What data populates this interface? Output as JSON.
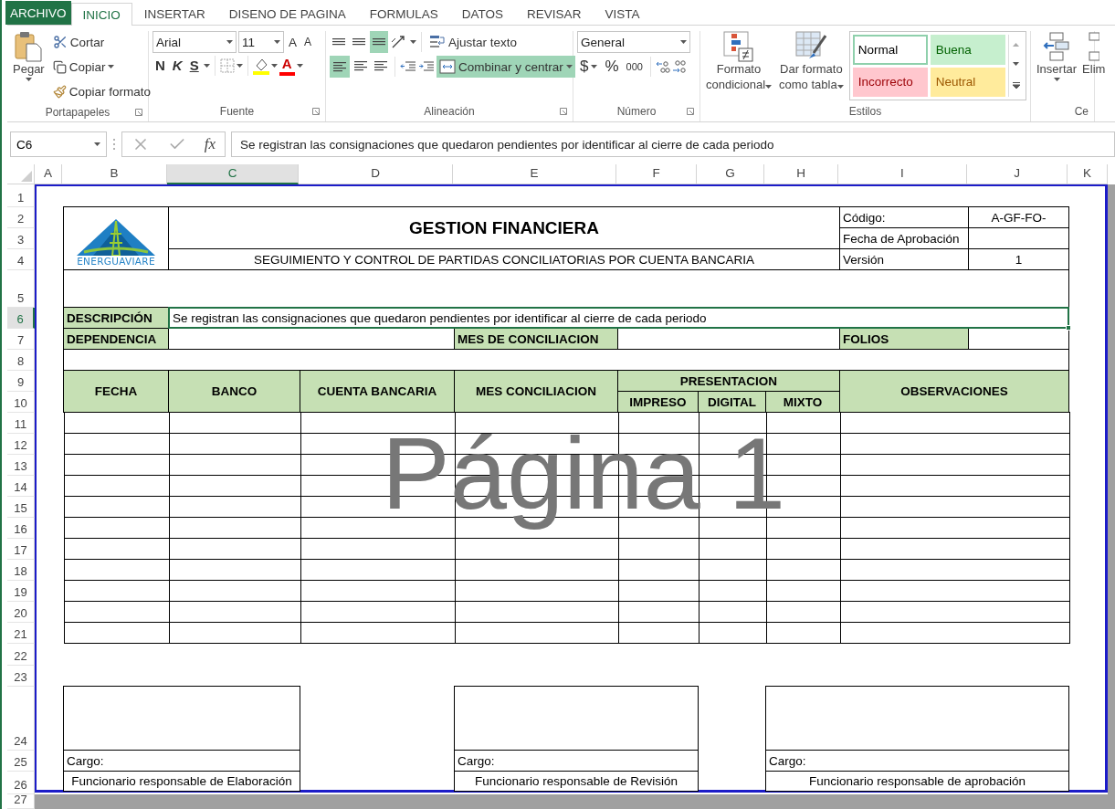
{
  "ribbon_tabs": [
    {
      "label": "ARCHIVO",
      "kind": "file",
      "selected": false
    },
    {
      "label": "INICIO",
      "kind": "tab",
      "selected": true
    },
    {
      "label": "INSERTAR",
      "kind": "tab",
      "selected": false
    },
    {
      "label": "DISENO DE PAGINA",
      "kind": "tab",
      "selected": false
    },
    {
      "label": "FORMULAS",
      "kind": "tab",
      "selected": false
    },
    {
      "label": "DATOS",
      "kind": "tab",
      "selected": false
    },
    {
      "label": "REVISAR",
      "kind": "tab",
      "selected": false
    },
    {
      "label": "VISTA",
      "kind": "tab",
      "selected": false
    }
  ],
  "ribbon": {
    "clipboard": {
      "paste": "Pegar",
      "cut": "Cortar",
      "copy": "Copiar",
      "format_painter": "Copiar formato",
      "label": "Portapapeles"
    },
    "font": {
      "name": "Arial",
      "size": "11",
      "grow": "A",
      "shrink": "A",
      "bold": "N",
      "italic": "K",
      "underline": "S",
      "font_color": "A",
      "label": "Fuente"
    },
    "alignment": {
      "wrap": "Ajustar texto",
      "merge": "Combinar y centrar",
      "bottom_align_on": true,
      "left_align_on": true,
      "merge_on": true,
      "label": "Alineación"
    },
    "number": {
      "format": "General",
      "currency": "$",
      "percent": "%",
      "thousands": "000",
      "label": "Número"
    },
    "styles": {
      "conditional": [
        "Formato",
        "condicional"
      ],
      "table": [
        "Dar formato",
        "como tabla"
      ],
      "label": "Estilos",
      "cells": [
        {
          "label": "Normal",
          "kind": "normal",
          "selected": true
        },
        {
          "label": "Buena",
          "kind": "good",
          "selected": false
        },
        {
          "label": "Incorrecto",
          "kind": "bad",
          "selected": false
        },
        {
          "label": "Neutral",
          "kind": "neutral",
          "selected": false
        }
      ]
    },
    "cells_group": {
      "insert": "Insertar",
      "delete": "Elim",
      "label": "Ce"
    }
  },
  "formula_bar": {
    "name_box": "C6",
    "fx": "fx",
    "formula": "Se registran las consignaciones que quedaron pendientes por identificar al cierre de cada periodo"
  },
  "columns": [
    {
      "label": "A",
      "selected": false
    },
    {
      "label": "B",
      "selected": false
    },
    {
      "label": "C",
      "selected": true
    },
    {
      "label": "D",
      "selected": false
    },
    {
      "label": "E",
      "selected": false
    },
    {
      "label": "F",
      "selected": false
    },
    {
      "label": "G",
      "selected": false
    },
    {
      "label": "H",
      "selected": false
    },
    {
      "label": "I",
      "selected": false
    },
    {
      "label": "J",
      "selected": false
    },
    {
      "label": "K",
      "selected": false
    }
  ],
  "rows": [
    {
      "label": "1",
      "selected": false
    },
    {
      "label": "2",
      "selected": false
    },
    {
      "label": "3",
      "selected": false
    },
    {
      "label": "4",
      "selected": false
    },
    {
      "label": "5",
      "selected": false
    },
    {
      "label": "6",
      "selected": true
    },
    {
      "label": "7",
      "selected": false
    },
    {
      "label": "8",
      "selected": false
    },
    {
      "label": "9",
      "selected": false
    },
    {
      "label": "10",
      "selected": false
    },
    {
      "label": "11",
      "selected": false
    },
    {
      "label": "12",
      "selected": false
    },
    {
      "label": "13",
      "selected": false
    },
    {
      "label": "14",
      "selected": false
    },
    {
      "label": "15",
      "selected": false
    },
    {
      "label": "16",
      "selected": false
    },
    {
      "label": "17",
      "selected": false
    },
    {
      "label": "18",
      "selected": false
    },
    {
      "label": "19",
      "selected": false
    },
    {
      "label": "20",
      "selected": false
    },
    {
      "label": "21",
      "selected": false
    },
    {
      "label": "22",
      "selected": false
    },
    {
      "label": "23",
      "selected": false
    },
    {
      "label": "24",
      "selected": false
    },
    {
      "label": "25",
      "selected": false
    },
    {
      "label": "26",
      "selected": false
    },
    {
      "label": "27",
      "selected": false
    }
  ],
  "cells": [
    {
      "kind": "logo",
      "text": "ENERGUAVIARE",
      "selected": false
    },
    {
      "kind": "title",
      "text": "GESTION FINANCIERA",
      "selected": false
    },
    {
      "kind": "value",
      "text": "SEGUIMIENTO Y CONTROL DE PARTIDAS CONCILIATORIAS POR CUENTA BANCARIA",
      "selected": false
    },
    {
      "kind": "label",
      "text": "Código:",
      "selected": false
    },
    {
      "kind": "value",
      "text": "A-GF-FO-",
      "selected": false
    },
    {
      "kind": "label",
      "text": "Fecha de Aprobación",
      "selected": false
    },
    {
      "kind": "label",
      "text": "Versión",
      "selected": false
    },
    {
      "kind": "value",
      "text": "1",
      "selected": false
    },
    {
      "kind": "field",
      "text": "DESCRIPCIÓN",
      "selected": false
    },
    {
      "kind": "label",
      "text": "Se registran las consignaciones que quedaron pendientes por identificar al cierre de cada periodo",
      "selected": true
    },
    {
      "kind": "field",
      "text": "DEPENDENCIA",
      "selected": false
    },
    {
      "kind": "field",
      "text": "MES DE CONCILIACION",
      "selected": false
    },
    {
      "kind": "field",
      "text": "FOLIOS",
      "selected": false
    },
    {
      "kind": "header",
      "text": "FECHA",
      "selected": false
    },
    {
      "kind": "header",
      "text": "BANCO",
      "selected": false
    },
    {
      "kind": "header",
      "text": "CUENTA BANCARIA",
      "selected": false
    },
    {
      "kind": "header",
      "text": "MES CONCILIACION",
      "selected": false
    },
    {
      "kind": "header",
      "text": "PRESENTACION",
      "selected": false
    },
    {
      "kind": "header",
      "text": "IMPRESO",
      "selected": false
    },
    {
      "kind": "header",
      "text": "DIGITAL",
      "selected": false
    },
    {
      "kind": "header",
      "text": "MIXTO",
      "selected": false
    },
    {
      "kind": "header",
      "text": "OBSERVACIONES",
      "selected": false
    },
    {
      "kind": "label",
      "text": "Cargo:",
      "selected": false
    },
    {
      "kind": "value",
      "text": "Funcionario responsable de Elaboración",
      "selected": false
    },
    {
      "kind": "label",
      "text": "Cargo:",
      "selected": false
    },
    {
      "kind": "value",
      "text": "Funcionario responsable de Revisión",
      "selected": false
    },
    {
      "kind": "label",
      "text": "Cargo:",
      "selected": false
    },
    {
      "kind": "value",
      "text": "Funcionario responsable de aprobación",
      "selected": false
    }
  ],
  "page_label": "Página 1"
}
